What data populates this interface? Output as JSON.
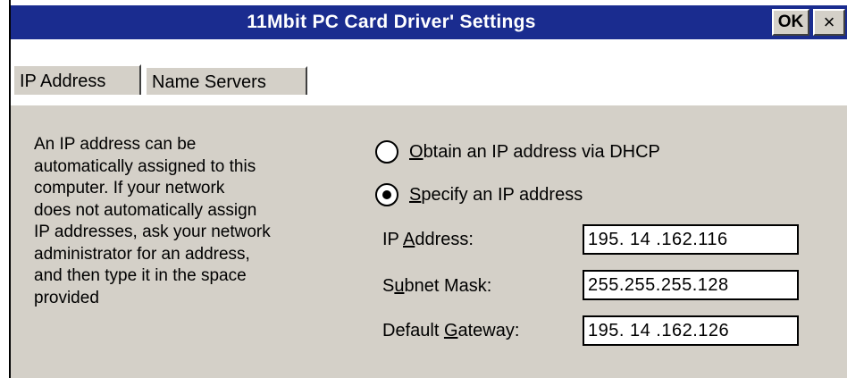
{
  "window": {
    "title": "11Mbit PC Card Driver' Settings",
    "ok_label": "OK",
    "close_label": "×"
  },
  "tabs": [
    {
      "label": "IP Address"
    },
    {
      "label": "Name Servers"
    }
  ],
  "description": [
    "An IP address can be",
    "automatically assigned to this",
    "computer.  If your network",
    "does not automatically assign",
    "IP addresses, ask your network",
    "administrator for an address,",
    "and then type it in the space",
    "provided"
  ],
  "options": {
    "dhcp": {
      "first": "O",
      "rest": "btain an IP address via DHCP",
      "selected": false
    },
    "specify": {
      "first": "S",
      "rest": "pecify an IP address",
      "selected": true
    }
  },
  "fields": {
    "ip": {
      "pre": "IP ",
      "key": "A",
      "post": "ddress:",
      "value": "195. 14 .162.116"
    },
    "subnet": {
      "pre": "S",
      "key": "u",
      "post": "bnet Mask:",
      "value": "255.255.255.128"
    },
    "gateway": {
      "pre": "Default ",
      "key": "G",
      "post": "ateway:",
      "value": "195. 14 .162.126"
    }
  }
}
